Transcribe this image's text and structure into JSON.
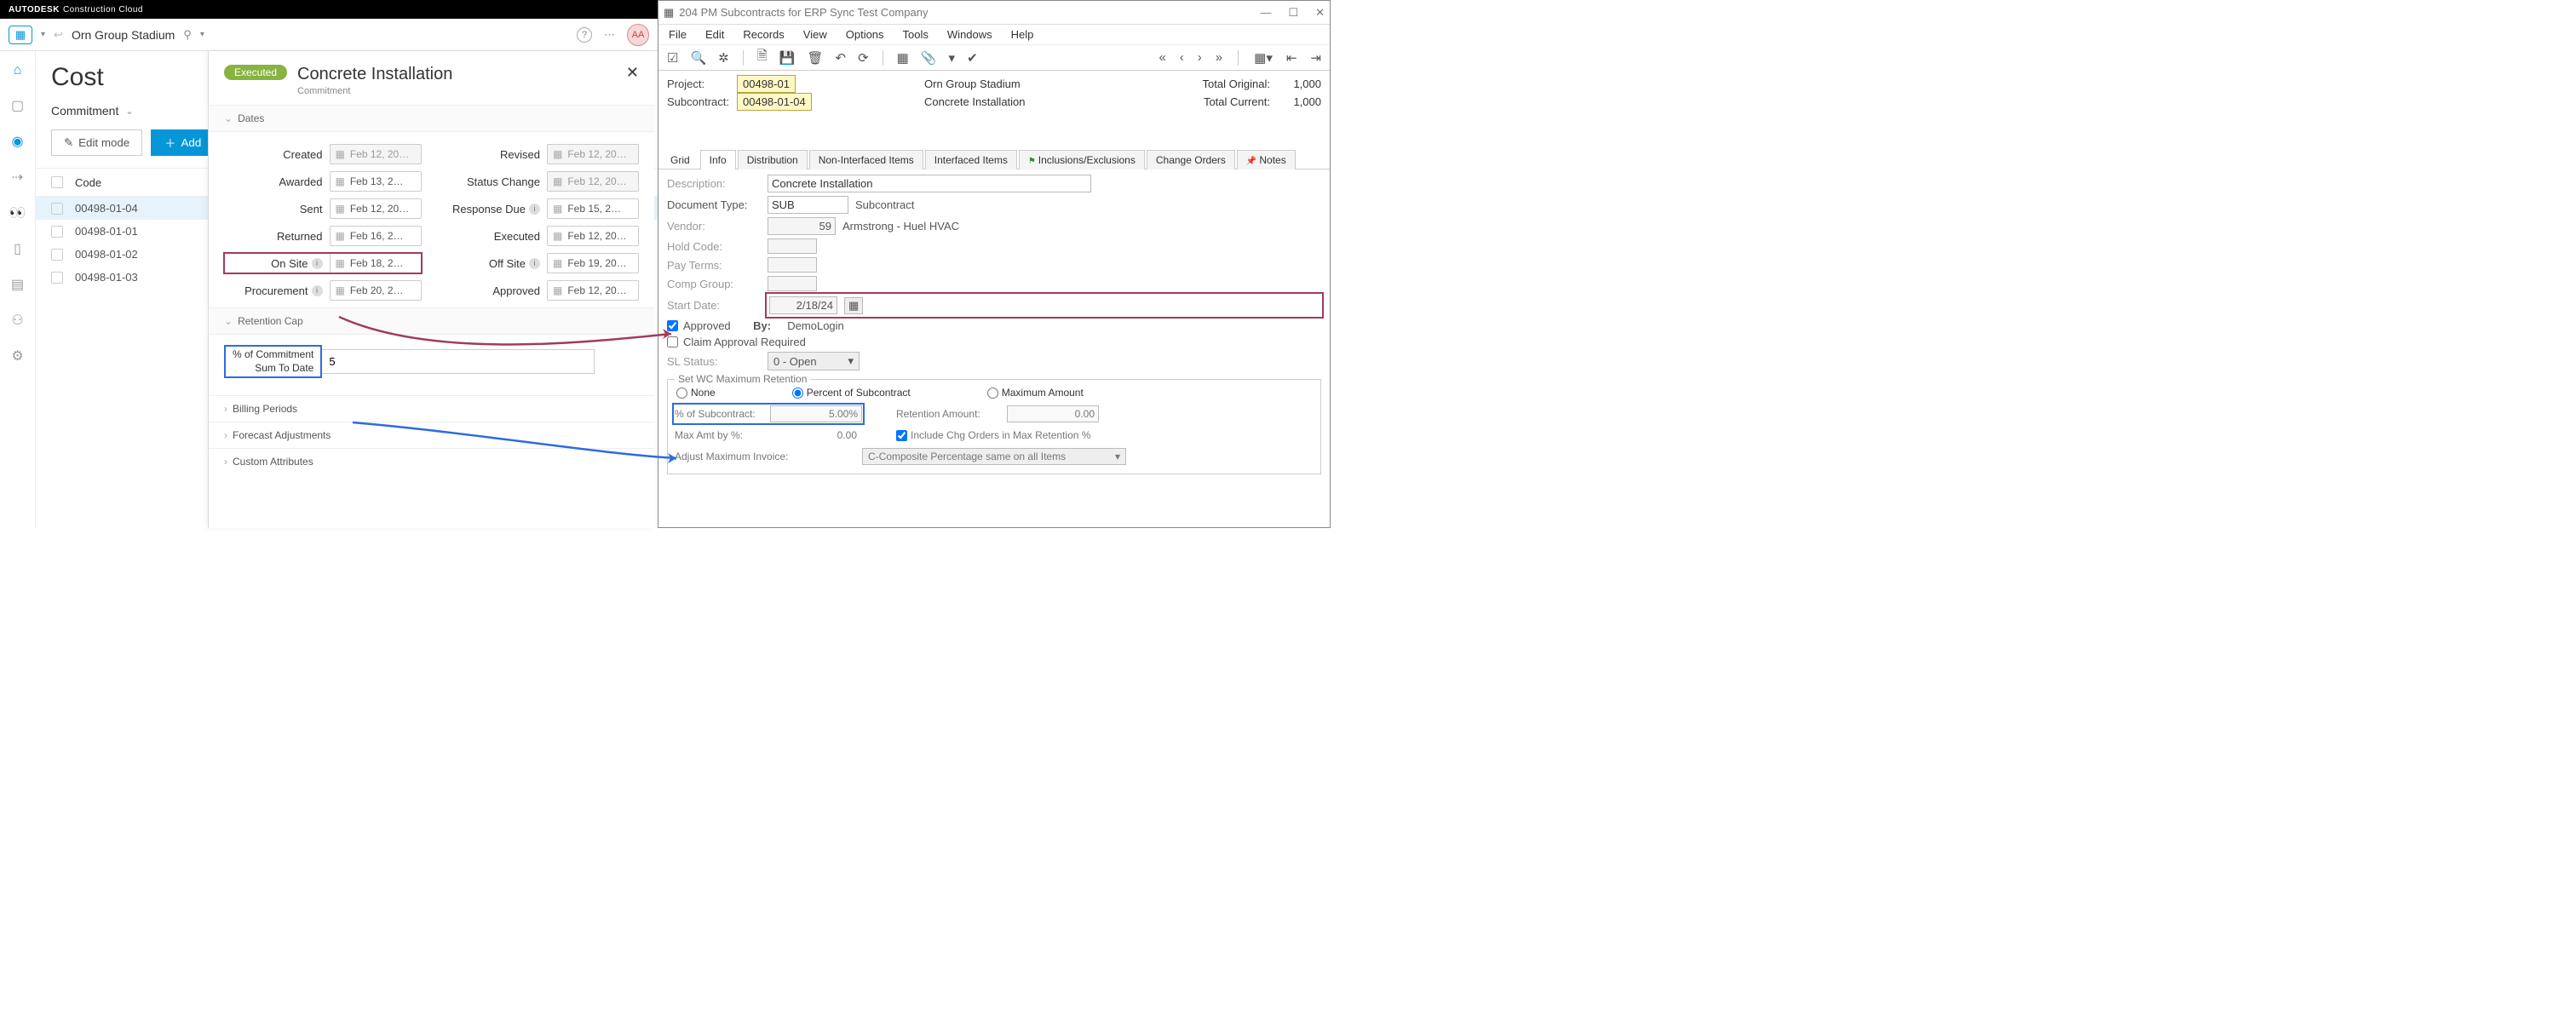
{
  "autodesk": {
    "brand": "AUTODESK",
    "brand_sub": "Construction Cloud",
    "project_name": "Orn Group Stadium",
    "avatar": "AA",
    "page_title": "Cost",
    "subnav_tab": "Commitment",
    "btn_edit": "Edit mode",
    "btn_add": "Add",
    "list_header": "Code",
    "items": [
      "00498-01-04",
      "00498-01-01",
      "00498-01-02",
      "00498-01-03"
    ],
    "slideover": {
      "status": "Executed",
      "title": "Concrete Installation",
      "subtitle": "Commitment",
      "section_dates": "Dates",
      "dates": {
        "created_lbl": "Created",
        "created_val": "Feb 12, 20…",
        "revised_lbl": "Revised",
        "revised_val": "Feb 12, 20…",
        "awarded_lbl": "Awarded",
        "awarded_val": "Feb 13, 2…",
        "statuschange_lbl": "Status Change",
        "statuschange_val": "Feb 12, 20…",
        "sent_lbl": "Sent",
        "sent_val": "Feb 12, 20…",
        "responsedue_lbl": "Response Due",
        "responsedue_val": "Feb 15, 2…",
        "returned_lbl": "Returned",
        "returned_val": "Feb 16, 2…",
        "executed_lbl": "Executed",
        "executed_val": "Feb 12, 20…",
        "onsite_lbl": "On Site",
        "onsite_val": "Feb 18, 2…",
        "offsite_lbl": "Off Site",
        "offsite_val": "Feb 19, 20…",
        "procurement_lbl": "Procurement",
        "procurement_val": "Feb 20, 2…",
        "approved_lbl": "Approved",
        "approved_val": "Feb 12, 20…"
      },
      "section_retention": "Retention Cap",
      "retention_label_l1": "% of Commitment",
      "retention_label_l2": "Sum To Date",
      "retention_value": "5",
      "coll_billing": "Billing Periods",
      "coll_forecast": "Forecast Adjustments",
      "coll_custom": "Custom Attributes"
    }
  },
  "erp": {
    "window_title": "204 PM Subcontracts for ERP Sync Test Company",
    "menu": [
      "File",
      "Edit",
      "Records",
      "View",
      "Options",
      "Tools",
      "Windows",
      "Help"
    ],
    "project_lbl": "Project:",
    "project_code": "00498-01",
    "project_name": "Orn Group Stadium",
    "subcontract_lbl": "Subcontract:",
    "subcontract_code": "00498-01-04",
    "subcontract_name": "Concrete Installation",
    "total_orig_lbl": "Total Original:",
    "total_orig_val": "1,000",
    "total_curr_lbl": "Total Current:",
    "total_curr_val": "1,000",
    "tabs": [
      "Grid",
      "Info",
      "Distribution",
      "Non-Interfaced Items",
      "Interfaced Items",
      "Inclusions/Exclusions",
      "Change Orders",
      "Notes"
    ],
    "form": {
      "desc_lbl": "Description:",
      "desc_val": "Concrete Installation",
      "doctype_lbl": "Document Type:",
      "doctype_val": "SUB",
      "doctype_name": "Subcontract",
      "vendor_lbl": "Vendor:",
      "vendor_num": "59",
      "vendor_name": "Armstrong - Huel HVAC",
      "hold_lbl": "Hold Code:",
      "payterms_lbl": "Pay Terms:",
      "compgroup_lbl": "Comp Group:",
      "startdate_lbl": "Start Date:",
      "startdate_val": "2/18/24",
      "approved_lbl": "Approved",
      "by_lbl": "By:",
      "by_val": "DemoLogin",
      "claim_lbl": "Claim Approval Required",
      "slstatus_lbl": "SL Status:",
      "slstatus_val": "0 - Open"
    },
    "fieldset": {
      "legend": "Set WC Maximum Retention",
      "r_none": "None",
      "r_pct": "Percent of Subcontract",
      "r_max": "Maximum Amount",
      "pct_lbl": "% of Subcontract:",
      "pct_val": "5.00%",
      "retamt_lbl": "Retention Amount:",
      "retamt_val": "0.00",
      "maxamt_lbl": "Max Amt by %:",
      "maxamt_val": "0.00",
      "incl_lbl": "Include Chg Orders in Max Retention %",
      "adjmax_lbl": "Adjust Maximum Invoice:",
      "adjmax_val": "C-Composite Percentage same on all Items"
    }
  }
}
